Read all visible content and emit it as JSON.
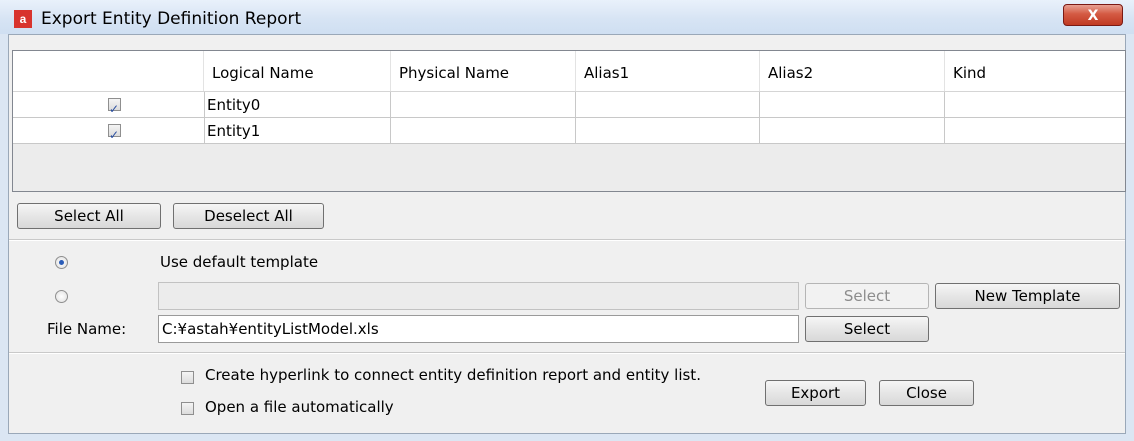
{
  "window": {
    "title": "Export Entity Definition Report",
    "app_icon": "astah-app-icon",
    "close_label": "X"
  },
  "table": {
    "columns": [
      "",
      "Logical Name",
      "Physical Name",
      "Alias1",
      "Alias2",
      "Kind"
    ],
    "rows": [
      {
        "checked": true,
        "logical_name": "Entity0",
        "physical_name": "",
        "alias1": "",
        "alias2": "",
        "kind": ""
      },
      {
        "checked": true,
        "logical_name": "Entity1",
        "physical_name": "",
        "alias1": "",
        "alias2": "",
        "kind": ""
      }
    ]
  },
  "selection": {
    "select_all_label": "Select All",
    "deselect_all_label": "Deselect All"
  },
  "template": {
    "default_selected": true,
    "default_label": "Use default template",
    "custom_path": "",
    "select_label": "Select",
    "new_template_label": "New Template",
    "file_name_label": "File Name:",
    "file_name_value": "C:¥astah¥entityListModel.xls",
    "file_select_label": "Select"
  },
  "options": {
    "hyperlink_checked": false,
    "hyperlink_label": "Create hyperlink to connect entity definition report and entity list.",
    "open_auto_checked": false,
    "open_auto_label": "Open a file automatically"
  },
  "actions": {
    "export_label": "Export",
    "close_label": "Close"
  }
}
